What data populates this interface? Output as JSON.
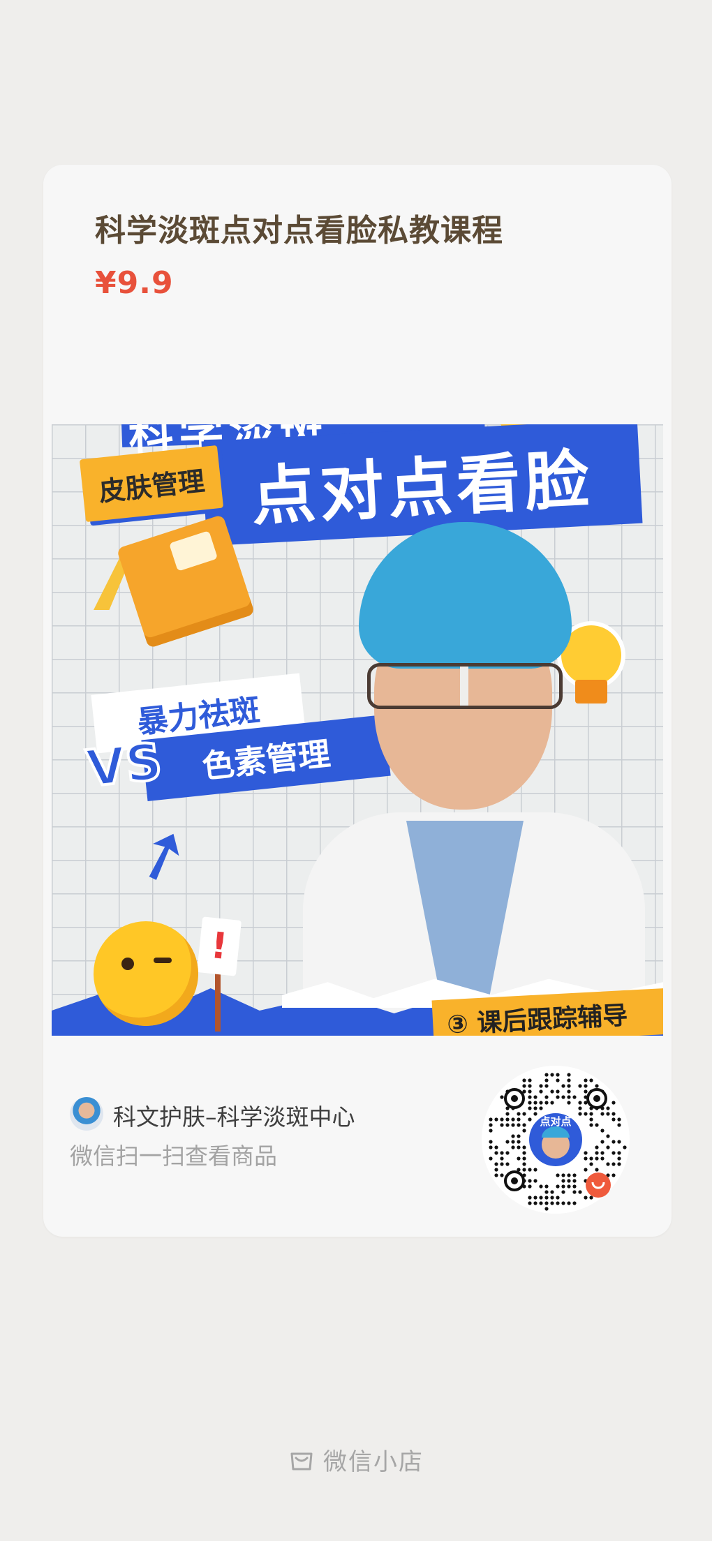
{
  "product": {
    "title": "科学淡斑点对点看脸私教课程",
    "price": "¥9.9"
  },
  "poster": {
    "banner_top": "科学淡斑",
    "banner_main": "点对点看脸",
    "tag_top_left": "皮肤管理",
    "vs_line_1": "暴力祛斑",
    "vs_mark": "VS",
    "vs_line_2": "色素管理",
    "sign_mark": "!",
    "bottom_label": "③ 课后跟踪辅导"
  },
  "shop": {
    "name": "科文护肤–科学淡斑中心",
    "scan_tip": "微信扫一扫查看商品"
  },
  "qr": {
    "center_text": "点对点"
  },
  "footer": {
    "brand": "微信小店"
  },
  "colors": {
    "price": "#e8513b",
    "accent_blue": "#2f5bd9",
    "accent_yellow": "#f9b22b",
    "qr_badge": "#ef5a3c"
  }
}
